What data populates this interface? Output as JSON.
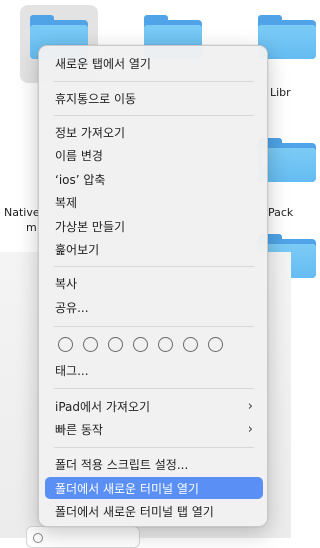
{
  "desktop": {
    "left_label_line1": "Native",
    "left_label_line2": "m",
    "right_label_top": "Libr",
    "right_label_mid": "Pack"
  },
  "context_menu": {
    "items": [
      {
        "label": "새로운 탭에서 열기"
      },
      {
        "label": "휴지통으로 이동"
      },
      {
        "label": "정보 가져오기"
      },
      {
        "label": "이름 변경"
      },
      {
        "label": "‘ios’ 압축"
      },
      {
        "label": "복제"
      },
      {
        "label": "가상본 만들기"
      },
      {
        "label": "훑어보기"
      },
      {
        "label": "복사"
      },
      {
        "label": "공유..."
      },
      {
        "label": "태그..."
      },
      {
        "label": "iPad에서 가져오기"
      },
      {
        "label": "빠른 동작"
      },
      {
        "label": "폴더 적용 스크립트 설정..."
      },
      {
        "label": "폴더에서 새로운 터미널 열기"
      },
      {
        "label": "폴더에서 새로운 터미널 탭 열기"
      }
    ],
    "tag_circle_count": 7,
    "highlighted_index": 14,
    "highlight_color": "#5a8ff5",
    "submenu_chevron": "›"
  }
}
